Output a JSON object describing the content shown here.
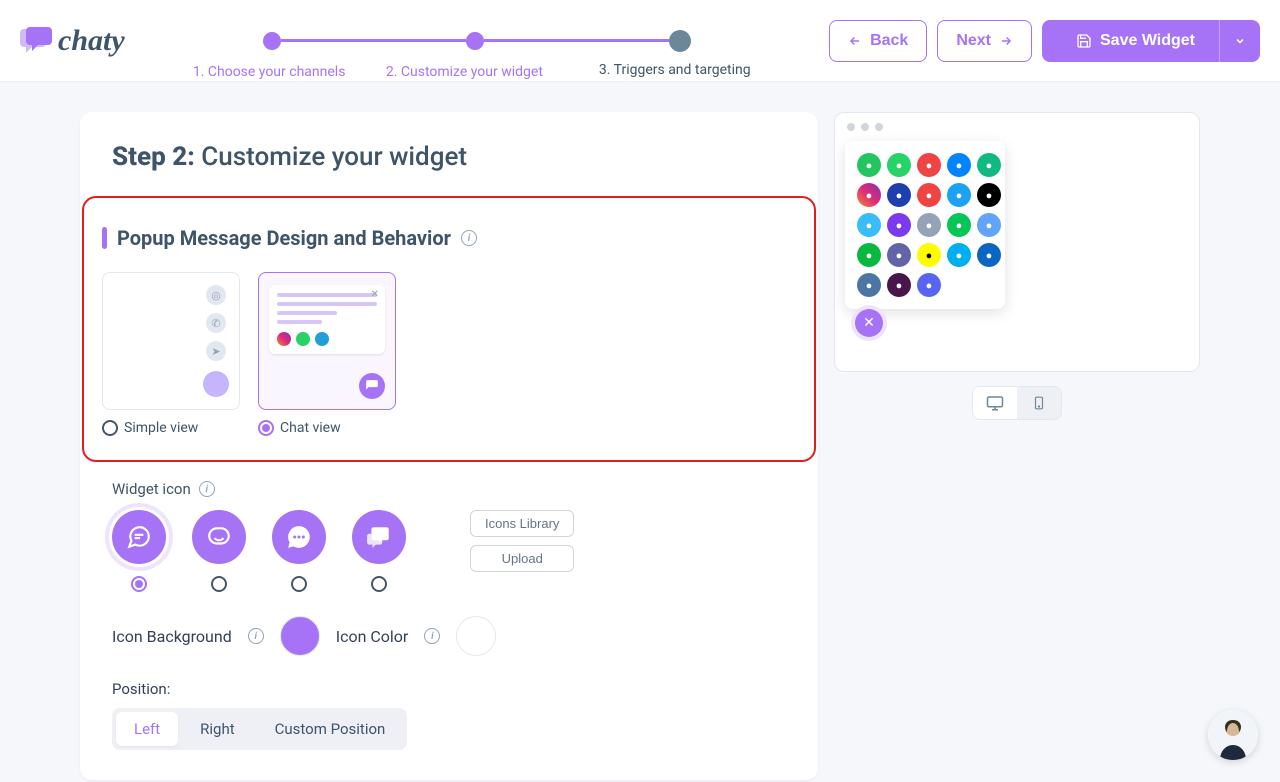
{
  "brand": {
    "name": "chaty"
  },
  "stepper": {
    "steps": [
      {
        "label": "1. Choose your channels",
        "state": "done"
      },
      {
        "label": "2. Customize your widget",
        "state": "done"
      },
      {
        "label": "3. Triggers and targeting",
        "state": "current"
      }
    ]
  },
  "actions": {
    "back": "Back",
    "next": "Next",
    "save": "Save Widget"
  },
  "page": {
    "step_prefix": "Step 2:",
    "step_title": "Customize your widget"
  },
  "popup_section": {
    "title": "Popup Message Design and Behavior",
    "options": [
      {
        "id": "simple",
        "label": "Simple view",
        "selected": false
      },
      {
        "id": "chat",
        "label": "Chat view",
        "selected": true
      }
    ]
  },
  "widget_icon": {
    "label": "Widget icon",
    "icons_library": "Icons Library",
    "upload": "Upload",
    "selected_index": 0,
    "options": [
      "chat-lines",
      "smile-bubble",
      "dots-bubble",
      "double-bubble"
    ]
  },
  "colors": {
    "bg_label": "Icon Background",
    "bg_value": "#a673f6",
    "fg_label": "Icon Color",
    "fg_value": "#ffffff"
  },
  "position": {
    "label": "Position:",
    "options": [
      "Left",
      "Right",
      "Custom Position"
    ],
    "selected": "Left"
  },
  "preview": {
    "device": "mobile",
    "channels": [
      {
        "name": "phone",
        "bg": "#22c55e"
      },
      {
        "name": "whatsapp",
        "bg": "#25d366"
      },
      {
        "name": "email",
        "bg": "#ef4444"
      },
      {
        "name": "messenger",
        "bg": "#0084ff"
      },
      {
        "name": "maps",
        "bg": "#10b981"
      },
      {
        "name": "instagram",
        "bg": "linear-gradient(45deg,#f58529,#dd2a7b,#8134af)"
      },
      {
        "name": "contact",
        "bg": "#1e40af"
      },
      {
        "name": "sms",
        "bg": "#ef4444"
      },
      {
        "name": "twitter",
        "bg": "#1da1f2"
      },
      {
        "name": "tiktok",
        "bg": "#000000"
      },
      {
        "name": "telegram",
        "bg": "#38bdf8"
      },
      {
        "name": "viber",
        "bg": "#7c3aed"
      },
      {
        "name": "form",
        "bg": "#94a3b8"
      },
      {
        "name": "line",
        "bg": "#06c755"
      },
      {
        "name": "chat",
        "bg": "#60a5fa"
      },
      {
        "name": "wechat",
        "bg": "#09b83e"
      },
      {
        "name": "teams",
        "bg": "#6264a7"
      },
      {
        "name": "snapchat",
        "bg": "#fffc00"
      },
      {
        "name": "skype",
        "bg": "#00aff0"
      },
      {
        "name": "linkedin",
        "bg": "#0a66c2"
      },
      {
        "name": "vk",
        "bg": "#4c75a3"
      },
      {
        "name": "slack",
        "bg": "#4a154b"
      },
      {
        "name": "discord",
        "bg": "#5865f2"
      }
    ]
  }
}
